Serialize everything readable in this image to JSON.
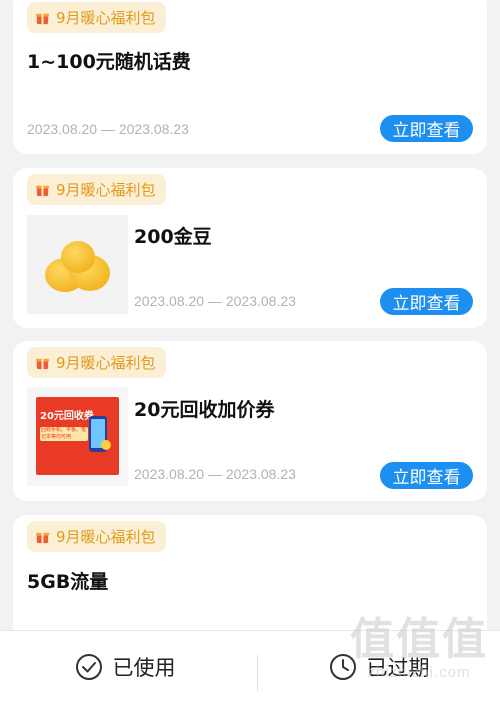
{
  "cards": [
    {
      "tag": "9月暖心福利包",
      "title": "1~100元随机话费",
      "date": "2023.08.20 — 2023.08.23",
      "button": "立即查看"
    },
    {
      "tag": "9月暖心福利包",
      "title": "200金豆",
      "date": "2023.08.20 — 2023.08.23",
      "button": "立即查看",
      "thumb_icon": "gold-bean-icon"
    },
    {
      "tag": "9月暖心福利包",
      "title": "20元回收加价券",
      "date": "2023.08.20 — 2023.08.23",
      "button": "立即查看",
      "thumb_text": "20元回收券",
      "thumb_subtext": "回收手机、平板、笔记本等均可用"
    },
    {
      "tag": "9月暖心福利包",
      "title": "5GB流量"
    }
  ],
  "bottom_bar": {
    "used_label": "已使用",
    "expired_label": "已过期"
  },
  "watermark": {
    "big": "值值值",
    "small": "zhizhizhi.com"
  },
  "colors": {
    "accent": "#1d8ff0",
    "tag_bg": "#fbf0d6",
    "tag_text": "#e09a1c"
  }
}
